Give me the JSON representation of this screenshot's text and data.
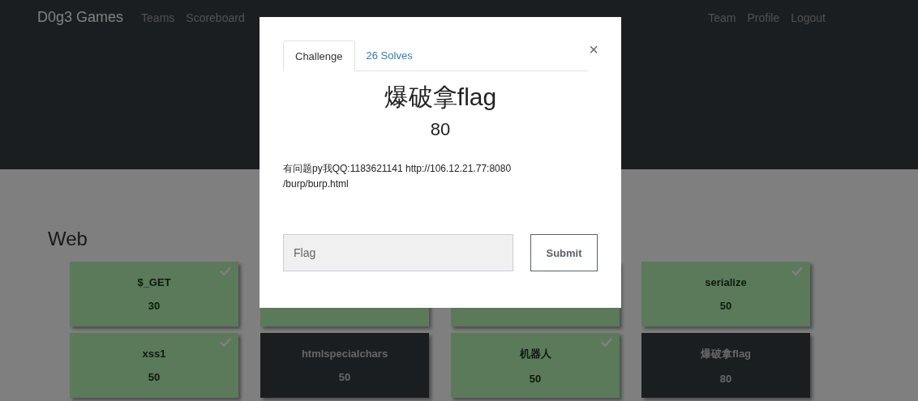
{
  "navbar": {
    "brand": "D0g3 Games",
    "left_links": [
      "Teams",
      "Scoreboard"
    ],
    "right_links": [
      "Team",
      "Profile",
      "Logout"
    ]
  },
  "category": {
    "title": "Web",
    "cards": [
      {
        "name": "$_GET",
        "value": "30",
        "solved": true
      },
      {
        "solved": true
      },
      {
        "solved": true
      },
      {
        "name": "serialize",
        "value": "50",
        "solved": true
      },
      {
        "name": "xss1",
        "value": "50",
        "solved": true
      },
      {
        "name": "htmlspecialchars",
        "value": "50",
        "solved": false
      },
      {
        "name": "机器人",
        "value": "50",
        "solved": true
      },
      {
        "name": "爆破拿flag",
        "value": "80",
        "solved": false
      }
    ]
  },
  "modal": {
    "tabs": [
      {
        "label": "Challenge",
        "selected": true
      },
      {
        "label": "26 Solves",
        "selected": false
      }
    ],
    "close": "×",
    "title": "爆破拿flag",
    "value": "80",
    "description_lines": [
      "有问题py我QQ:1183621141 http://106.12.21.77:8080",
      "/burp/burp.html"
    ],
    "flag_field": {
      "placeholder": "Flag"
    },
    "submit": "Submit"
  }
}
